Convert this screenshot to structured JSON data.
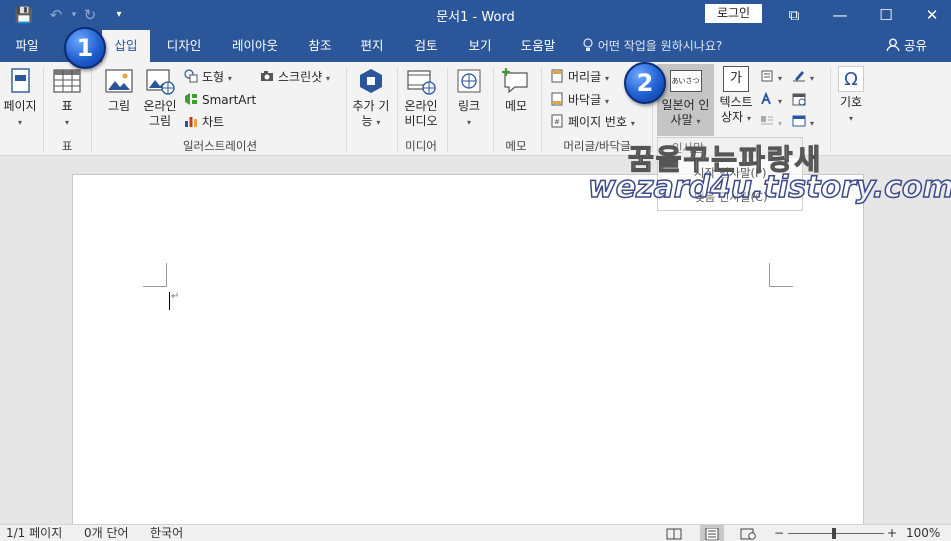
{
  "titlebar": {
    "title": "문서1  -  Word",
    "login": "로그인",
    "qat_save": "💾",
    "qat_undo": "↶",
    "qat_undo_menu": "▾",
    "qat_redo": "↻",
    "qat_customize": "▾"
  },
  "window": {
    "restore": "⧉",
    "minimize": "—",
    "maximize": "☐",
    "close": "✕"
  },
  "tabs": [
    "파일",
    "삽입",
    "디자인",
    "레이아웃",
    "참조",
    "편지",
    "검토",
    "보기",
    "도움말"
  ],
  "tellme": "어떤 작업을 원하시나요?",
  "share": "공유",
  "ribbon": {
    "pages": {
      "label": "페이지"
    },
    "table": {
      "label": "표",
      "group": "표"
    },
    "pictures": {
      "label": "그림"
    },
    "online_pictures": {
      "label1": "온라인",
      "label2": "그림"
    },
    "shapes": "도형",
    "smartart": "SmartArt",
    "chart": "차트",
    "screenshot": "스크린샷",
    "illustrations_group": "일러스트레이션",
    "addins": {
      "label1": "추가 기",
      "label2": "능"
    },
    "online_video": {
      "label1": "온라인",
      "label2": "비디오",
      "group": "미디어"
    },
    "link": {
      "label": "링크"
    },
    "comment": {
      "label": "메모",
      "group": "메모"
    },
    "header": "머리글",
    "footer": "바닥글",
    "page_number": "페이지 번호",
    "header_footer_group": "머리글/바닥글",
    "japanese_greeting": {
      "label1": "일본어 인",
      "label2": "사말",
      "icon_text": "あいさつ"
    },
    "textbox": {
      "label1": "텍스트",
      "label2": "상자",
      "icon_text": "가"
    },
    "symbol": {
      "label": "기호",
      "icon": "Ω"
    }
  },
  "dropdown": {
    "header": "인사말",
    "item1": "시작 인사말(P)",
    "item2": "맺음 인사말(C)"
  },
  "statusbar": {
    "page": "1/1 페이지",
    "words": "0개 단어",
    "language": "한국어",
    "zoom": "100%",
    "minus": "−",
    "plus": "+"
  },
  "callouts": {
    "one": "1",
    "two": "2"
  },
  "watermark": {
    "line1": "꿈을꾸는파랑새",
    "line2": "wezard4u.tistory.com"
  },
  "colors": {
    "accent": "#2b579a"
  }
}
